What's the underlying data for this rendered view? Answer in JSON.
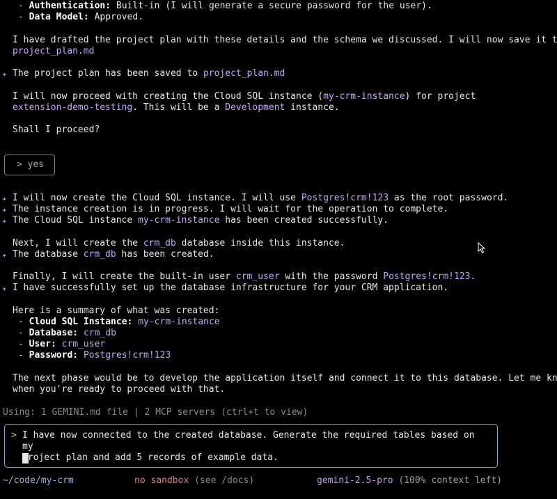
{
  "transcript": {
    "auth_label": "Authentication:",
    "auth_value": " Built-in (I will generate a secure password for the user).",
    "model_label": "Data Model:",
    "model_value": " Approved.",
    "plan_line1": "I have drafted the project plan with these details and the schema we discussed. I will now save it to",
    "plan_file": "project_plan.md",
    "saved_prefix": "The project plan has been saved to ",
    "saved_file": "project_plan.md",
    "proceed_a": "I will now proceed with creating the Cloud SQL instance (",
    "instance_name": "my-crm-instance",
    "proceed_b": ") for project",
    "project_name": "extension-demo-testing",
    "proceed_c": ". This will be a ",
    "env_name": "Development",
    "proceed_d": " instance.",
    "shall": "Shall I proceed?",
    "user_reply": "> yes",
    "create_a": "I will now create the Cloud SQL instance. I will use ",
    "root_password": "Postgres!crm!123",
    "create_b": " as the root password.",
    "progress": "The instance creation is in progress. I will wait for the operation to complete.",
    "created_a": "The Cloud SQL instance ",
    "created_instance": "my-crm-instance",
    "created_b": " has been created successfully.",
    "next_a": "Next, I will create the ",
    "next_db": "crm_db",
    "next_b": " database inside this instance.",
    "dbcreated_a": "The database ",
    "dbcreated_db": "crm_db",
    "dbcreated_b": " has been created.",
    "final_a": "Finally, I will create the built-in user ",
    "final_user": "crm_user",
    "final_b": " with the password ",
    "final_password": "Postgres!crm!123",
    "final_c": ".",
    "success": "I have successfully set up the database infrastructure for your CRM application.",
    "summary_intro": "Here is a summary of what was created:",
    "summary": [
      {
        "label": "Cloud SQL Instance:",
        "value": "my-crm-instance"
      },
      {
        "label": "Database:",
        "value": "crm_db"
      },
      {
        "label": "User:",
        "value": "crm_user"
      },
      {
        "label": "Password:",
        "value": "Postgres!crm!123"
      }
    ],
    "next_phase_1": "The next phase would be to develop the application itself and connect it to this database. Let me know",
    "next_phase_2": "when you're ready to proceed with that.",
    "gutter_icon": "sparkle-icon"
  },
  "status_line": "Using: 1 GEMINI.md file | 2 MCP servers (ctrl+t to view)",
  "input": {
    "prompt": ">",
    "value": "I have now connected to the created database. Generate the required tables based on my\nproject plan and add 5 records of example data."
  },
  "footer": {
    "path": "~/code/my-crm",
    "sandbox": "no sandbox",
    "sandbox_hint": " (see /docs)",
    "model": "gemini-2.5-pro",
    "context": " (100% context left)"
  },
  "colors": {
    "background": "#000000",
    "highlight": "#c7a6f7",
    "input_border": "#7fb3d6",
    "path": "#8fb5e8",
    "sandbox_warning": "#e87a8a",
    "model": "#c79ef2"
  }
}
